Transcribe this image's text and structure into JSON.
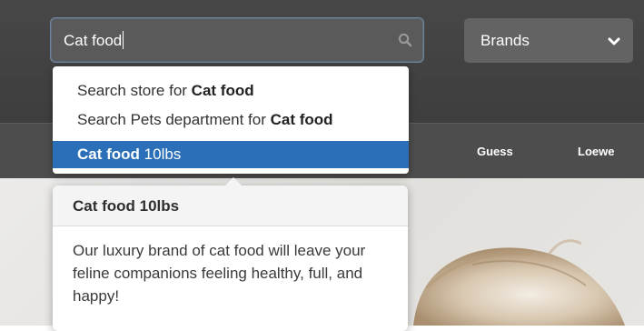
{
  "header": {
    "search": {
      "value": "Cat food",
      "icon": "search-icon"
    },
    "brands_select": {
      "selected": "Brands",
      "icon": "chevron-down-icon"
    }
  },
  "nav": {
    "links": [
      "Guess",
      "Loewe"
    ]
  },
  "suggestions": [
    {
      "prefix": "Search store for ",
      "bold": "Cat food",
      "suffix": ""
    },
    {
      "prefix": "Search Pets department for ",
      "bold": "Cat food",
      "suffix": ""
    },
    {
      "prefix": "",
      "bold": "Cat food",
      "suffix": " 10lbs",
      "active": true
    }
  ],
  "popover": {
    "title": "Cat food 10lbs",
    "body": "Our luxury brand of cat food will leave your feline companions feeling healthy, full, and happy!"
  },
  "colors": {
    "header_bg": "#474747",
    "active_suggestion": "#2a6fb7",
    "search_focus_border": "#6d87a2"
  }
}
